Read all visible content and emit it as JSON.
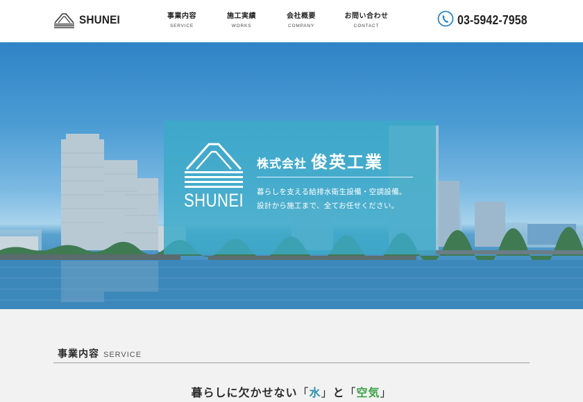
{
  "header": {
    "logo_text": "SHUNEI",
    "nav": [
      {
        "label": "事業内容",
        "sub": "SERVICE"
      },
      {
        "label": "施工実績",
        "sub": "WORKS"
      },
      {
        "label": "会社概要",
        "sub": "COMPANY"
      },
      {
        "label": "お問い合わせ",
        "sub": "CONTACT"
      }
    ],
    "phone": "03-5942-7958",
    "phone_icon": "phone-icon"
  },
  "hero": {
    "brand": "SHUNEI",
    "title_prefix": "株式会社",
    "title_name": "俊英工業",
    "desc_line1": "暮らしを支える給排水衛生設備・空調設備。",
    "desc_line2": "設計から施工まで、全てお任せください。"
  },
  "service": {
    "heading": "事業内容",
    "heading_en": "SERVICE",
    "tagline_pre": "暮らしに欠かせない",
    "keyword_water": "水",
    "tagline_mid": "と",
    "keyword_air": "空気",
    "bracket_open": "「",
    "bracket_close": "」"
  },
  "colors": {
    "header_bg": "#ffffff",
    "hero_card": "#3caac8",
    "keyword_water": "#2a8fb0",
    "keyword_air": "#3aa246",
    "section_bg": "#f2f2f2"
  }
}
